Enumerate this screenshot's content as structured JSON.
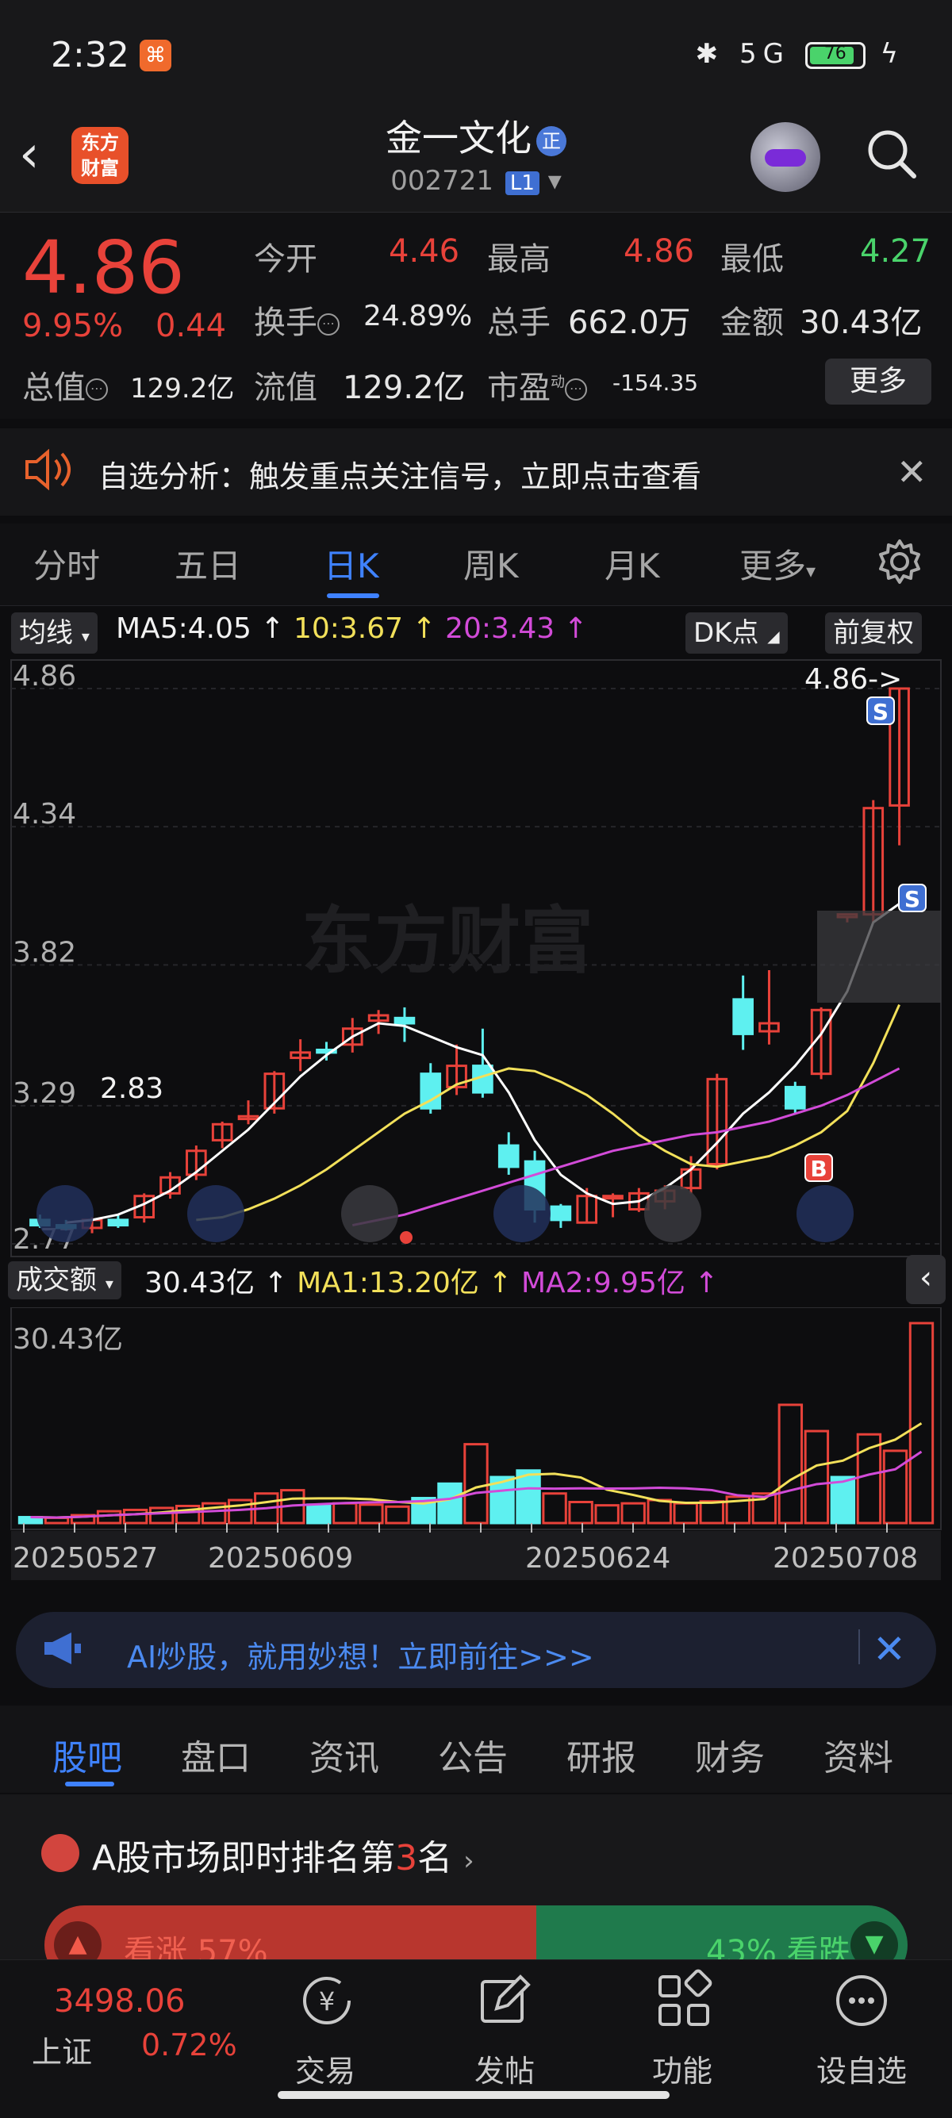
{
  "status_bar": {
    "time": "2:32",
    "battery": "76",
    "network": "5G"
  },
  "header": {
    "back_icon": "back-arrow-icon",
    "app_logo": "东方\n财富",
    "stock_name": "金一文化",
    "name_badge": "正",
    "stock_code": "002721",
    "level_badge": "L1",
    "assistant_icon": "robot-avatar-icon",
    "search_icon": "search-icon"
  },
  "quote": {
    "price": "4.86",
    "change_pct": "9.95%",
    "change_amt": "0.44",
    "fields": {
      "open_label": "今开",
      "open_value": "4.46",
      "high_label": "最高",
      "high_value": "4.86",
      "low_label": "最低",
      "low_value": "4.27",
      "turnover_label": "换手",
      "turnover_value": "24.89%",
      "volume_label": "总手",
      "volume_value": "662.0万",
      "amount_label": "金额",
      "amount_value": "30.43亿",
      "mktcap_label": "总值",
      "mktcap_value": "129.2亿",
      "float_label": "流值",
      "float_value": "129.2亿",
      "pe_label": "市盈",
      "pe_sup": "动",
      "pe_value": "-154.35"
    },
    "more_label": "更多"
  },
  "notice": {
    "text": "自选分析：触发重点关注信号，立即点击查看",
    "close_icon": "close-icon"
  },
  "period_tabs": [
    {
      "label": "分时",
      "active": false
    },
    {
      "label": "五日",
      "active": false
    },
    {
      "label": "日K",
      "active": true
    },
    {
      "label": "周K",
      "active": false
    },
    {
      "label": "月K",
      "active": false
    },
    {
      "label": "更多",
      "active": false
    }
  ],
  "chart_header": {
    "indicator_select": "均线",
    "ma5": "MA5:4.05",
    "ma10": "10:3.67",
    "ma20": "20:3.43",
    "dk_select": "DK点",
    "adjust_select": "前复权"
  },
  "chart_data": [
    {
      "type": "candlestick",
      "y_ticks": [
        "4.86",
        "4.34",
        "3.82",
        "3.29",
        "2.77"
      ],
      "ylim": [
        2.77,
        4.86
      ],
      "last_price_label": "4.86->",
      "low_label": "2.83",
      "watermark": "东方财富",
      "candles": [
        [
          2.86,
          2.84,
          2.88,
          2.83
        ],
        [
          2.84,
          2.83,
          2.86,
          2.82
        ],
        [
          2.83,
          2.86,
          2.87,
          2.81
        ],
        [
          2.86,
          2.84,
          2.88,
          2.83
        ],
        [
          2.87,
          2.95,
          2.96,
          2.85
        ],
        [
          2.96,
          3.02,
          3.04,
          2.94
        ],
        [
          3.03,
          3.12,
          3.14,
          3.01
        ],
        [
          3.16,
          3.22,
          3.23,
          3.13
        ],
        [
          3.24,
          3.25,
          3.31,
          3.22
        ],
        [
          3.28,
          3.41,
          3.42,
          3.26
        ],
        [
          3.47,
          3.49,
          3.54,
          3.42
        ],
        [
          3.5,
          3.49,
          3.53,
          3.46
        ],
        [
          3.52,
          3.58,
          3.62,
          3.49
        ],
        [
          3.61,
          3.63,
          3.65,
          3.56
        ],
        [
          3.62,
          3.6,
          3.66,
          3.53
        ],
        [
          3.41,
          3.28,
          3.45,
          3.26
        ],
        [
          3.36,
          3.44,
          3.52,
          3.33
        ],
        [
          3.44,
          3.34,
          3.58,
          3.32
        ],
        [
          3.14,
          3.06,
          3.19,
          3.03
        ],
        [
          3.08,
          2.9,
          3.12,
          2.85
        ],
        [
          2.91,
          2.86,
          2.92,
          2.83
        ],
        [
          2.85,
          2.95,
          2.98,
          2.85
        ],
        [
          2.95,
          2.95,
          2.96,
          2.87
        ],
        [
          2.9,
          2.96,
          2.98,
          2.89
        ],
        [
          2.93,
          2.97,
          2.99,
          2.9
        ],
        [
          2.98,
          3.05,
          3.1,
          2.96
        ],
        [
          3.07,
          3.39,
          3.41,
          3.05
        ],
        [
          3.69,
          3.56,
          3.78,
          3.5
        ],
        [
          3.57,
          3.6,
          3.8,
          3.52
        ],
        [
          3.36,
          3.28,
          3.38,
          3.26
        ],
        [
          3.41,
          3.65,
          3.66,
          3.39
        ],
        [
          4.0,
          4.01,
          4.0,
          3.98
        ],
        [
          4.01,
          4.41,
          4.44,
          3.98
        ],
        [
          4.42,
          4.86,
          4.86,
          4.27
        ]
      ],
      "ma_series": [
        {
          "name": "MA5",
          "color": "#ffffff",
          "values": [
            2.85,
            2.86,
            2.88,
            2.92,
            2.97,
            3.04,
            3.12,
            3.2,
            3.3,
            3.4,
            3.48,
            3.55,
            3.6,
            3.59,
            3.55,
            3.51,
            3.48,
            3.34,
            3.16,
            3.03,
            2.96,
            2.92,
            2.93,
            2.98,
            3.05,
            3.15,
            3.26,
            3.34,
            3.44,
            3.56,
            3.72,
            3.98,
            4.05
          ]
        },
        {
          "name": "MA10",
          "color": "#f2e05a",
          "values": [
            2.86,
            2.87,
            2.9,
            2.94,
            2.99,
            3.05,
            3.12,
            3.19,
            3.26,
            3.31,
            3.37,
            3.4,
            3.43,
            3.42,
            3.38,
            3.33,
            3.26,
            3.18,
            3.12,
            3.07,
            3.06,
            3.08,
            3.1,
            3.14,
            3.19,
            3.27,
            3.45,
            3.67
          ]
        },
        {
          "name": "MA20",
          "color": "#d24bd8",
          "values": [
            2.84,
            2.86,
            2.88,
            2.91,
            2.94,
            2.97,
            3.0,
            3.03,
            3.06,
            3.09,
            3.12,
            3.14,
            3.16,
            3.18,
            3.19,
            3.21,
            3.23,
            3.26,
            3.29,
            3.33,
            3.38,
            3.43
          ]
        }
      ],
      "signals": [
        "S",
        "S",
        "B"
      ]
    },
    {
      "type": "bar",
      "title": "成交额",
      "value_label": "30.43亿",
      "ma1": "MA1:13.20亿",
      "ma2": "MA2:9.95亿",
      "y_top_label": "30.43亿",
      "x_ticks": [
        "20250527",
        "20250609",
        "20250624",
        "20250708"
      ],
      "values": [
        0.9,
        0.8,
        1.2,
        1.8,
        2.0,
        2.3,
        2.6,
        3.0,
        3.5,
        4.5,
        5.0,
        2.8,
        3.0,
        2.8,
        2.5,
        3.8,
        6.0,
        12.0,
        7.0,
        8.0,
        4.5,
        3.2,
        2.7,
        3.0,
        3.5,
        3.0,
        3.3,
        4.0,
        4.5,
        18.0,
        14.0,
        7.0,
        13.5,
        11.0,
        30.43
      ],
      "up": [
        false,
        true,
        true,
        true,
        true,
        true,
        true,
        true,
        true,
        true,
        true,
        false,
        true,
        true,
        true,
        false,
        false,
        true,
        false,
        false,
        true,
        true,
        true,
        true,
        true,
        true,
        true,
        true,
        true,
        true,
        true,
        false,
        true,
        true,
        true
      ]
    }
  ],
  "ad_banner": {
    "text": "AI炒股，就用妙想！立即前往>>>",
    "icon": "megaphone-icon",
    "close_icon": "close-icon"
  },
  "info_tabs": [
    {
      "label": "股吧",
      "active": true
    },
    {
      "label": "盘口",
      "active": false
    },
    {
      "label": "资讯",
      "active": false
    },
    {
      "label": "公告",
      "active": false
    },
    {
      "label": "研报",
      "active": false
    },
    {
      "label": "财务",
      "active": false
    },
    {
      "label": "资料",
      "active": false
    }
  ],
  "ranking": {
    "prefix": "A股市场即时排名第",
    "rank": "3",
    "suffix": "名"
  },
  "vote": {
    "up_label": "看涨 57%",
    "down_label": "43% 看跌",
    "up_pct": 57,
    "up_color": "#b8362e",
    "down_color": "#1f7a4c"
  },
  "bottom_nav": {
    "index_value": "3498.06",
    "index_name": "上证",
    "index_pct": "0.72%",
    "items": [
      {
        "label": "交易",
        "icon": "yuan-exchange-icon"
      },
      {
        "label": "发帖",
        "icon": "edit-icon"
      },
      {
        "label": "功能",
        "icon": "grid-icon"
      },
      {
        "label": "设自选",
        "icon": "more-dots-icon"
      }
    ]
  }
}
